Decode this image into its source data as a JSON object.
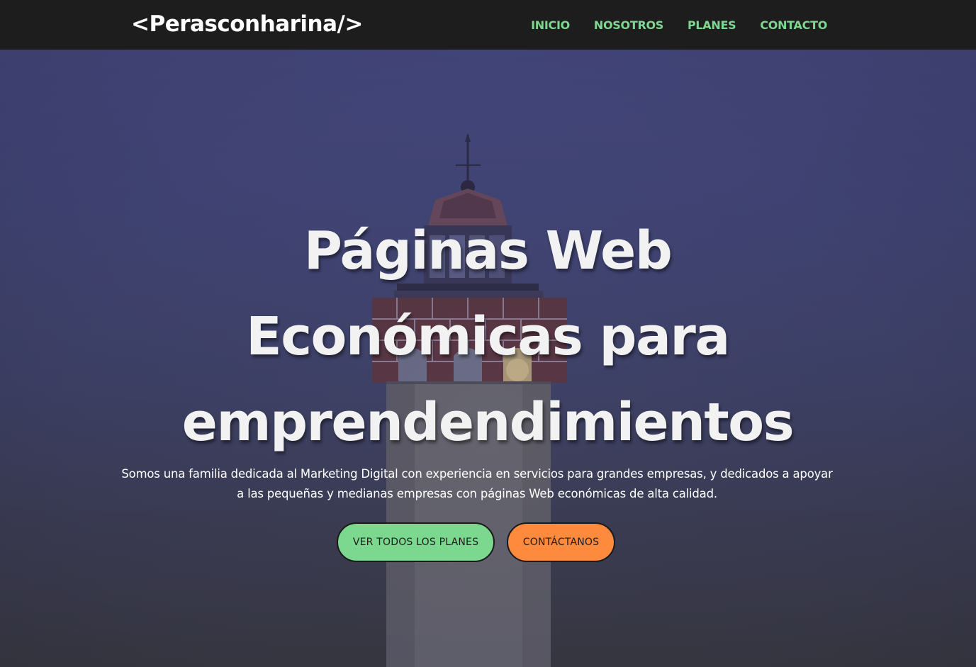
{
  "header": {
    "logo": "<Perasconharina/>",
    "nav": [
      {
        "label": "INICIO"
      },
      {
        "label": "NOSOTROS"
      },
      {
        "label": "PLANES"
      },
      {
        "label": "CONTACTO"
      }
    ]
  },
  "hero": {
    "title_lines": [
      "Páginas Web",
      "Económicas para",
      "emprendendimientos"
    ],
    "description": "Somos una familia dedicada al Marketing Digital con experiencia en servicios para grandes empresas, y dedicados a apoyar a las pequeñas y medianas empresas con páginas Web económicas de alta calidad.",
    "buttons": {
      "plans": "VER TODOS LOS PLANES",
      "contact": "CONTÁCTANOS"
    }
  },
  "colors": {
    "navbar_bg": "#1d1d1e",
    "nav_link": "#7cd88f",
    "btn_plans": "#7cd88f",
    "btn_contact": "#fe8a3e",
    "hero_overlay": "#44477a"
  }
}
